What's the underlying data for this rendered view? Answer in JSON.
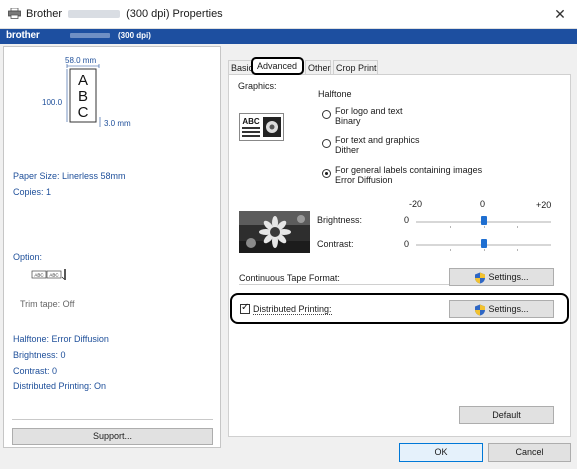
{
  "window": {
    "title_prefix": "Brother",
    "title_suffix": "(300 dpi) Properties",
    "close_glyph": "✕"
  },
  "brand": {
    "logo": "brother",
    "model_suffix": "(300 dpi)"
  },
  "preview": {
    "width_label": "58.0 mm",
    "height_label": "100.0",
    "margin_label": "3.0 mm",
    "letters": [
      "A",
      "B",
      "C"
    ]
  },
  "summary": {
    "paper_size": "Paper Size: Linerless 58mm",
    "copies": "Copies: 1",
    "option": "Option:",
    "trim_tape": "Trim tape: Off",
    "halftone": "Halftone: Error Diffusion",
    "brightness": "Brightness:   0",
    "contrast": "Contrast:   0",
    "distributed": "Distributed Printing: On"
  },
  "support_button": "Support...",
  "tabs": [
    {
      "label": "Basic",
      "active": false
    },
    {
      "label": "Advanced",
      "active": true
    },
    {
      "label": "Other",
      "active": false
    },
    {
      "label": "Crop Print",
      "active": false
    }
  ],
  "advanced": {
    "graphics_label": "Graphics:",
    "halftone_label": "Halftone",
    "options": [
      {
        "line1": "For logo and text",
        "line2": "Binary",
        "checked": false
      },
      {
        "line1": "For text and graphics",
        "line2": "Dither",
        "checked": false
      },
      {
        "line1": "For general labels containing images",
        "line2": "Error Diffusion",
        "checked": true
      }
    ],
    "scale_min": "-20",
    "scale_mid": "0",
    "scale_max": "+20",
    "brightness_label": "Brightness:",
    "brightness_value": "0",
    "contrast_label": "Contrast:",
    "contrast_value": "0",
    "continuous_label": "Continuous Tape Format:",
    "settings_button": "Settings...",
    "distributed_label": "Distributed Printing:",
    "distributed_checked": true,
    "default_button": "Default"
  },
  "footer": {
    "ok": "OK",
    "cancel": "Cancel"
  },
  "colors": {
    "brand_blue": "#1d4fa0",
    "summary_text": "#1e4f9a",
    "slider_thumb": "#1f6fd1"
  },
  "icons": [
    "printer-icon",
    "close-icon",
    "shield-icon",
    "sunflower-thumbnail",
    "abc-graphic-icon"
  ]
}
